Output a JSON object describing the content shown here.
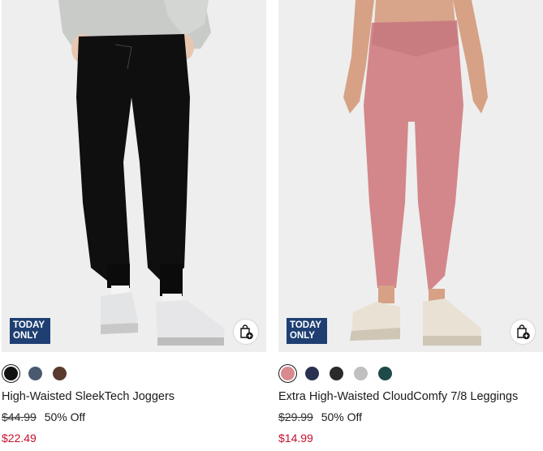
{
  "products": [
    {
      "badge_line1": "TODAY",
      "badge_line2": "ONLY",
      "name": "High-Waisted SleekTech Joggers",
      "original_price": "$44.99",
      "discount": "50% Off",
      "sale_price": "$22.49",
      "swatch_colors": [
        "#111111",
        "#4a5a6e",
        "#5a3a2e"
      ]
    },
    {
      "badge_line1": "TODAY",
      "badge_line2": "ONLY",
      "name": "Extra High-Waisted CloudComfy 7/8 Leggings",
      "original_price": "$29.99",
      "discount": "50% Off",
      "sale_price": "$14.99",
      "swatch_colors": [
        "#d98a8e",
        "#2a3050",
        "#2a2a2a",
        "#c0c0c0",
        "#1e4a4a"
      ]
    }
  ],
  "colors": {
    "badge_bg": "#1f3f73",
    "sale": "#c8102e"
  }
}
